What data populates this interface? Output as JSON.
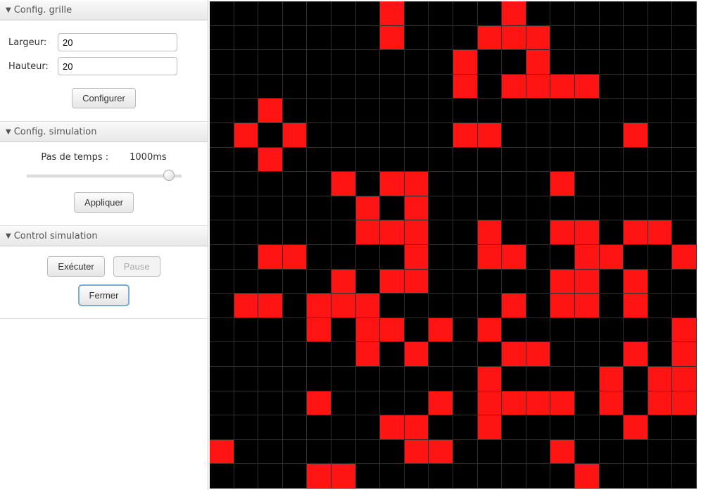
{
  "panels": {
    "grid_config": {
      "title": "Config. grille",
      "width_label": "Largeur:",
      "height_label": "Hauteur:",
      "width_value": "20",
      "height_value": "20",
      "configure_btn": "Configurer"
    },
    "sim_config": {
      "title": "Config. simulation",
      "timestep_label": "Pas de temps :",
      "timestep_value": "1000ms",
      "slider_position_pct": 92,
      "apply_btn": "Appliquer"
    },
    "sim_control": {
      "title": "Control simulation",
      "run_btn": "Exécuter",
      "pause_btn": "Pause",
      "pause_disabled": true,
      "close_btn": "Fermer",
      "close_focused": true
    }
  },
  "grid": {
    "cols": 20,
    "rows": 20,
    "alive_color": "#ff1414",
    "dead_color": "#000000",
    "cells": [
      [
        0,
        0,
        0,
        0,
        0,
        0,
        0,
        1,
        0,
        0,
        0,
        0,
        1,
        0,
        0,
        0,
        0,
        0,
        0,
        0
      ],
      [
        0,
        0,
        0,
        0,
        0,
        0,
        0,
        1,
        0,
        0,
        0,
        1,
        1,
        1,
        0,
        0,
        0,
        0,
        0,
        0
      ],
      [
        0,
        0,
        0,
        0,
        0,
        0,
        0,
        0,
        0,
        0,
        1,
        0,
        0,
        1,
        0,
        0,
        0,
        0,
        0,
        0
      ],
      [
        0,
        0,
        0,
        0,
        0,
        0,
        0,
        0,
        0,
        0,
        1,
        0,
        1,
        1,
        1,
        1,
        0,
        0,
        0,
        0
      ],
      [
        0,
        0,
        1,
        0,
        0,
        0,
        0,
        0,
        0,
        0,
        0,
        0,
        0,
        0,
        0,
        0,
        0,
        0,
        0,
        0
      ],
      [
        0,
        1,
        0,
        1,
        0,
        0,
        0,
        0,
        0,
        0,
        1,
        1,
        0,
        0,
        0,
        0,
        0,
        1,
        0,
        0
      ],
      [
        0,
        0,
        1,
        0,
        0,
        0,
        0,
        0,
        0,
        0,
        0,
        0,
        0,
        0,
        0,
        0,
        0,
        0,
        0,
        0
      ],
      [
        0,
        0,
        0,
        0,
        0,
        1,
        0,
        1,
        1,
        0,
        0,
        0,
        0,
        0,
        1,
        0,
        0,
        0,
        0,
        0
      ],
      [
        0,
        0,
        0,
        0,
        0,
        0,
        1,
        0,
        1,
        0,
        0,
        0,
        0,
        0,
        0,
        0,
        0,
        0,
        0,
        0
      ],
      [
        0,
        0,
        0,
        0,
        0,
        0,
        1,
        1,
        1,
        0,
        0,
        1,
        0,
        0,
        1,
        1,
        0,
        1,
        1,
        0
      ],
      [
        0,
        0,
        1,
        1,
        0,
        0,
        0,
        0,
        1,
        0,
        0,
        1,
        1,
        0,
        0,
        1,
        1,
        0,
        0,
        1
      ],
      [
        0,
        0,
        0,
        0,
        0,
        1,
        0,
        1,
        1,
        0,
        0,
        0,
        0,
        0,
        1,
        1,
        0,
        1,
        0,
        0
      ],
      [
        0,
        1,
        1,
        0,
        1,
        1,
        1,
        0,
        0,
        0,
        0,
        0,
        1,
        0,
        1,
        1,
        0,
        1,
        0,
        0
      ],
      [
        0,
        0,
        0,
        0,
        1,
        0,
        1,
        1,
        0,
        1,
        0,
        1,
        0,
        0,
        0,
        0,
        0,
        0,
        0,
        1
      ],
      [
        0,
        0,
        0,
        0,
        0,
        0,
        1,
        0,
        1,
        0,
        0,
        0,
        1,
        1,
        0,
        0,
        0,
        1,
        0,
        1
      ],
      [
        0,
        0,
        0,
        0,
        0,
        0,
        0,
        0,
        0,
        0,
        0,
        1,
        0,
        0,
        0,
        0,
        1,
        0,
        1,
        1
      ],
      [
        0,
        0,
        0,
        0,
        1,
        0,
        0,
        0,
        0,
        1,
        0,
        1,
        1,
        1,
        1,
        0,
        1,
        0,
        1,
        1
      ],
      [
        0,
        0,
        0,
        0,
        0,
        0,
        0,
        1,
        1,
        0,
        0,
        1,
        0,
        0,
        0,
        0,
        0,
        1,
        0,
        0
      ],
      [
        1,
        0,
        0,
        0,
        0,
        0,
        0,
        0,
        1,
        1,
        0,
        0,
        0,
        0,
        1,
        0,
        0,
        0,
        0,
        0
      ],
      [
        0,
        0,
        0,
        0,
        1,
        1,
        0,
        0,
        0,
        0,
        0,
        0,
        0,
        0,
        0,
        1,
        0,
        0,
        0,
        0
      ]
    ]
  }
}
